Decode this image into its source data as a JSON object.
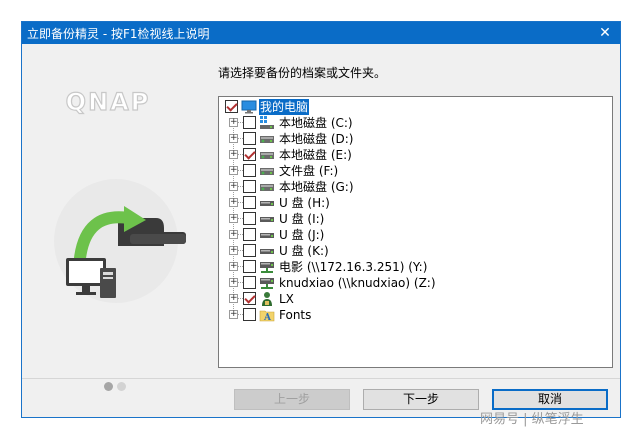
{
  "window": {
    "title": "立即备份精灵 - 按F1检视线上说明",
    "close_glyph": "✕"
  },
  "brand": {
    "logo_text": "QNAP"
  },
  "instruction": "请选择要备份的档案或文件夹。",
  "tree": [
    {
      "label": "我的电脑",
      "checked": true,
      "icon": "computer-icon",
      "selected": true
    },
    {
      "label": "本地磁盘 (C:)",
      "checked": false,
      "icon": "windows-drive-icon"
    },
    {
      "label": "本地磁盘 (D:)",
      "checked": false,
      "icon": "hard-drive-icon"
    },
    {
      "label": "本地磁盘 (E:)",
      "checked": true,
      "icon": "hard-drive-icon"
    },
    {
      "label": "文件盘 (F:)",
      "checked": false,
      "icon": "hard-drive-icon"
    },
    {
      "label": "本地磁盘 (G:)",
      "checked": false,
      "icon": "hard-drive-icon"
    },
    {
      "label": "U 盘 (H:)",
      "checked": false,
      "icon": "usb-drive-icon"
    },
    {
      "label": "U 盘 (I:)",
      "checked": false,
      "icon": "usb-drive-icon"
    },
    {
      "label": "U 盘 (J:)",
      "checked": false,
      "icon": "usb-drive-icon"
    },
    {
      "label": "U 盘 (K:)",
      "checked": false,
      "icon": "usb-drive-icon"
    },
    {
      "label": "电影 (\\\\172.16.3.251) (Y:)",
      "checked": false,
      "icon": "network-drive-icon"
    },
    {
      "label": "knudxiao (\\\\knudxiao) (Z:)",
      "checked": false,
      "icon": "network-drive-icon"
    },
    {
      "label": "LX",
      "checked": true,
      "icon": "user-folder-icon"
    },
    {
      "label": "Fonts",
      "checked": false,
      "icon": "fonts-folder-icon"
    }
  ],
  "buttons": {
    "prev": "上一步",
    "next": "下一步",
    "cancel": "取消"
  },
  "watermark": "网易号 | 纵笔浮生",
  "colors": {
    "accent": "#0a6cc7",
    "check": "#b03030",
    "arrow_green": "#6dc24b"
  }
}
